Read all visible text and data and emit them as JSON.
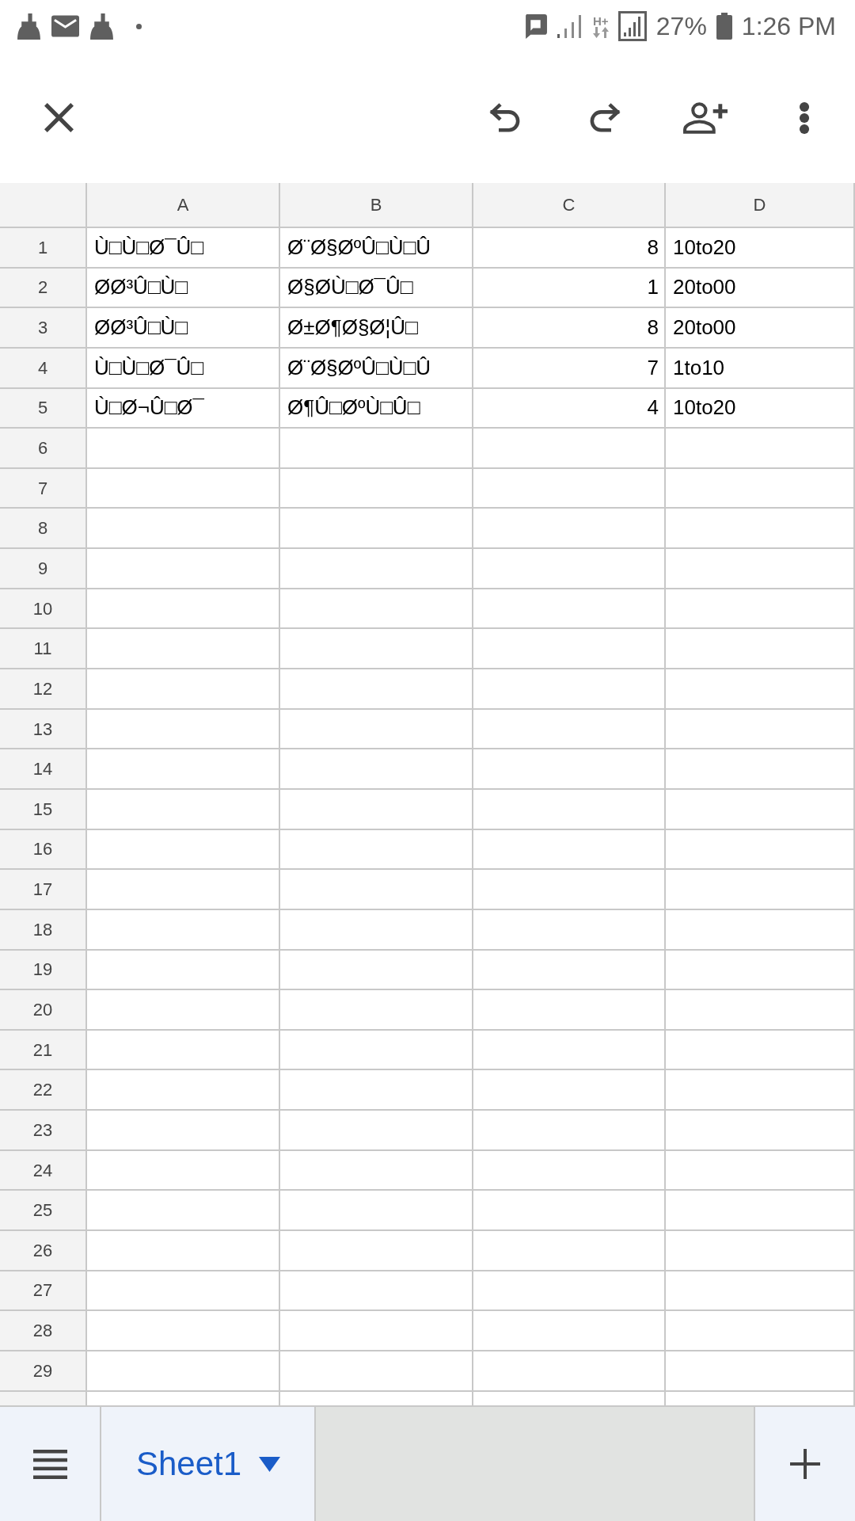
{
  "status_bar": {
    "network_type": "H+",
    "battery": "27%",
    "time": "1:26 PM"
  },
  "sheet": {
    "columns": [
      {
        "label": "A",
        "kind": "text"
      },
      {
        "label": "B",
        "kind": "text"
      },
      {
        "label": "C",
        "kind": "number"
      },
      {
        "label": "D",
        "kind": "text"
      }
    ],
    "rows": [
      {
        "number": "1",
        "cells": [
          "Ù□Ù□Ø¯Û□",
          "Ø¨Ø§ØºÛ□Ù□Û",
          "8",
          "10to20"
        ]
      },
      {
        "number": "2",
        "cells": [
          "ØØ³Û□Ù□",
          "Ø§ØÙ□Ø¯Û□",
          "1",
          "20to00"
        ]
      },
      {
        "number": "3",
        "cells": [
          "ØØ³Û□Ù□",
          "Ø±Ø¶Ø§Ø¦Û□",
          "8",
          "20to00"
        ]
      },
      {
        "number": "4",
        "cells": [
          "Ù□Ù□Ø¯Û□",
          "Ø¨Ø§ØºÛ□Ù□Û",
          "7",
          "1to10"
        ]
      },
      {
        "number": "5",
        "cells": [
          "Ù□Ø¬Û□Ø¯",
          "Ø¶Û□ØºÙ□Û□",
          "4",
          "10to20"
        ]
      },
      {
        "number": "6"
      },
      {
        "number": "7"
      },
      {
        "number": "8"
      },
      {
        "number": "9"
      },
      {
        "number": "10"
      },
      {
        "number": "11"
      },
      {
        "number": "12"
      },
      {
        "number": "13"
      },
      {
        "number": "14"
      },
      {
        "number": "15"
      },
      {
        "number": "16"
      },
      {
        "number": "17"
      },
      {
        "number": "18"
      },
      {
        "number": "19"
      },
      {
        "number": "20"
      },
      {
        "number": "21"
      },
      {
        "number": "22"
      },
      {
        "number": "23"
      },
      {
        "number": "24"
      },
      {
        "number": "25"
      },
      {
        "number": "26"
      },
      {
        "number": "27"
      },
      {
        "number": "28"
      },
      {
        "number": "29"
      }
    ]
  },
  "sheet_tabs": [
    {
      "label": "Sheet1",
      "selected": true
    }
  ]
}
